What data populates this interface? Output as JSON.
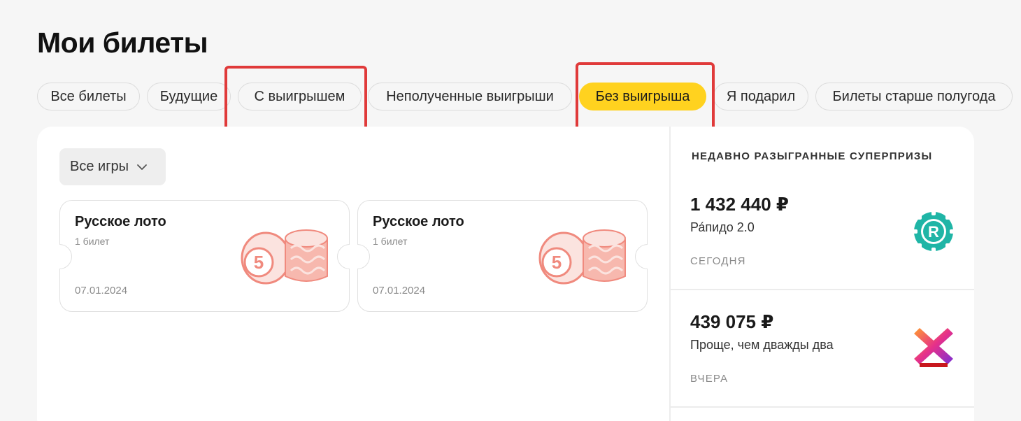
{
  "header": {
    "title": "Мои билеты"
  },
  "tabs": [
    {
      "label": "Все билеты",
      "active": false
    },
    {
      "label": "Будущие",
      "active": false
    },
    {
      "label": "С выигрышем",
      "active": false
    },
    {
      "label": "Неполученные выигрыши",
      "active": false
    },
    {
      "label": "Без выигрыша",
      "active": true
    },
    {
      "label": "Я подарил",
      "active": false
    },
    {
      "label": "Билеты старше полугода",
      "active": false
    }
  ],
  "filter": {
    "game_select_value": "Все игры",
    "icon": "chevron-down-icon"
  },
  "tickets": [
    {
      "game": "Русское лото",
      "count": "1 билет",
      "date": "07.01.2024",
      "icon": "loto-barrels-icon"
    },
    {
      "game": "Русское лото",
      "count": "1 билет",
      "date": "07.01.2024",
      "icon": "loto-barrels-icon"
    }
  ],
  "sidebar": {
    "title": "НЕДАВНО РАЗЫГРАННЫЕ СУПЕРПРИЗЫ",
    "prizes": [
      {
        "amount": "1 432 440 ₽",
        "game": "Ра́пидо 2.0",
        "when": "СЕГОДНЯ",
        "icon": "rapido-logo-icon"
      },
      {
        "amount": "439 075 ₽",
        "game": "Проще, чем дважды два",
        "when": "ВЧЕРА",
        "icon": "x-game-logo-icon"
      }
    ]
  },
  "colors": {
    "accent_yellow": "#ffd21f",
    "highlight_red": "#e03a3a",
    "loto_barrel": "#f08a7e",
    "rapido_teal": "#1fb5a6"
  }
}
